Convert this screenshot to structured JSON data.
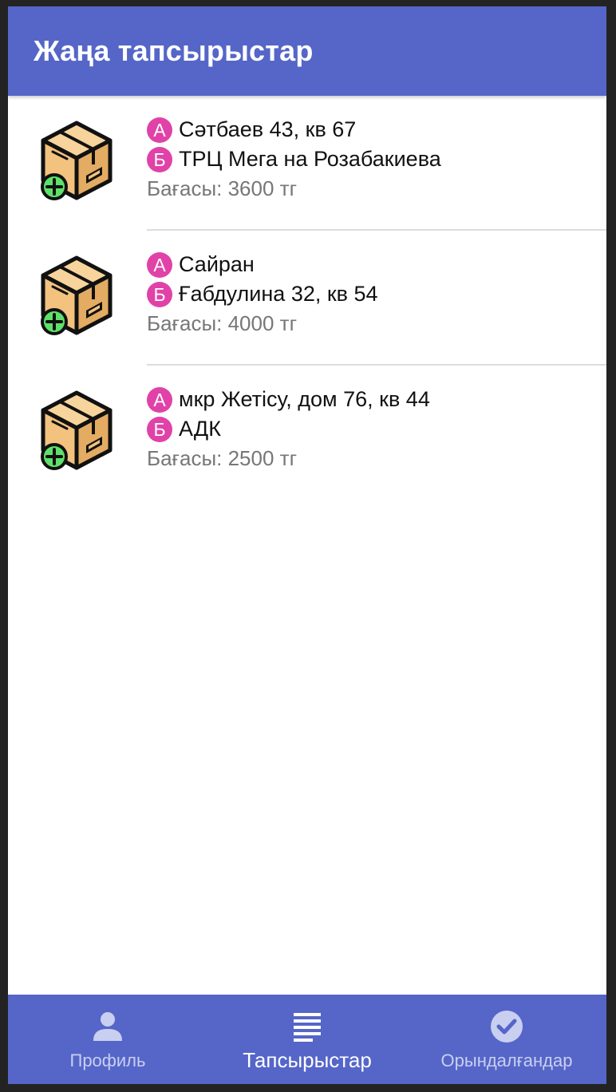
{
  "header": {
    "title": "Жаңа тапсырыстар"
  },
  "orders": [
    {
      "from_marker": "А",
      "from": "Сәтбаев 43, кв 67",
      "to_marker": "Б",
      "to": "ТРЦ Мега на Розабакиева",
      "price": "Бағасы: 3600 тг",
      "icon": "package-add-icon"
    },
    {
      "from_marker": "А",
      "from": "Сайран",
      "to_marker": "Б",
      "to": "Ғабдулина 32, кв 54",
      "price": "Бағасы: 4000 тг",
      "icon": "package-add-icon"
    },
    {
      "from_marker": "А",
      "from": "мкр Жетісу, дом 76, кв 44",
      "to_marker": "Б",
      "to": "АДК",
      "price": "Бағасы: 2500 тг",
      "icon": "package-add-icon"
    }
  ],
  "bottom_nav": {
    "items": [
      {
        "label": "Профиль",
        "icon": "person-icon",
        "active": false
      },
      {
        "label": "Тапсырыстар",
        "icon": "list-icon",
        "active": true
      },
      {
        "label": "Орындалғандар",
        "icon": "check-circle-icon",
        "active": false
      }
    ]
  },
  "colors": {
    "primary": "#5566c8",
    "marker": "#e042a8",
    "price_text": "#777777",
    "box_fill": "#f5c98a",
    "plus_green": "#5fe06a"
  }
}
